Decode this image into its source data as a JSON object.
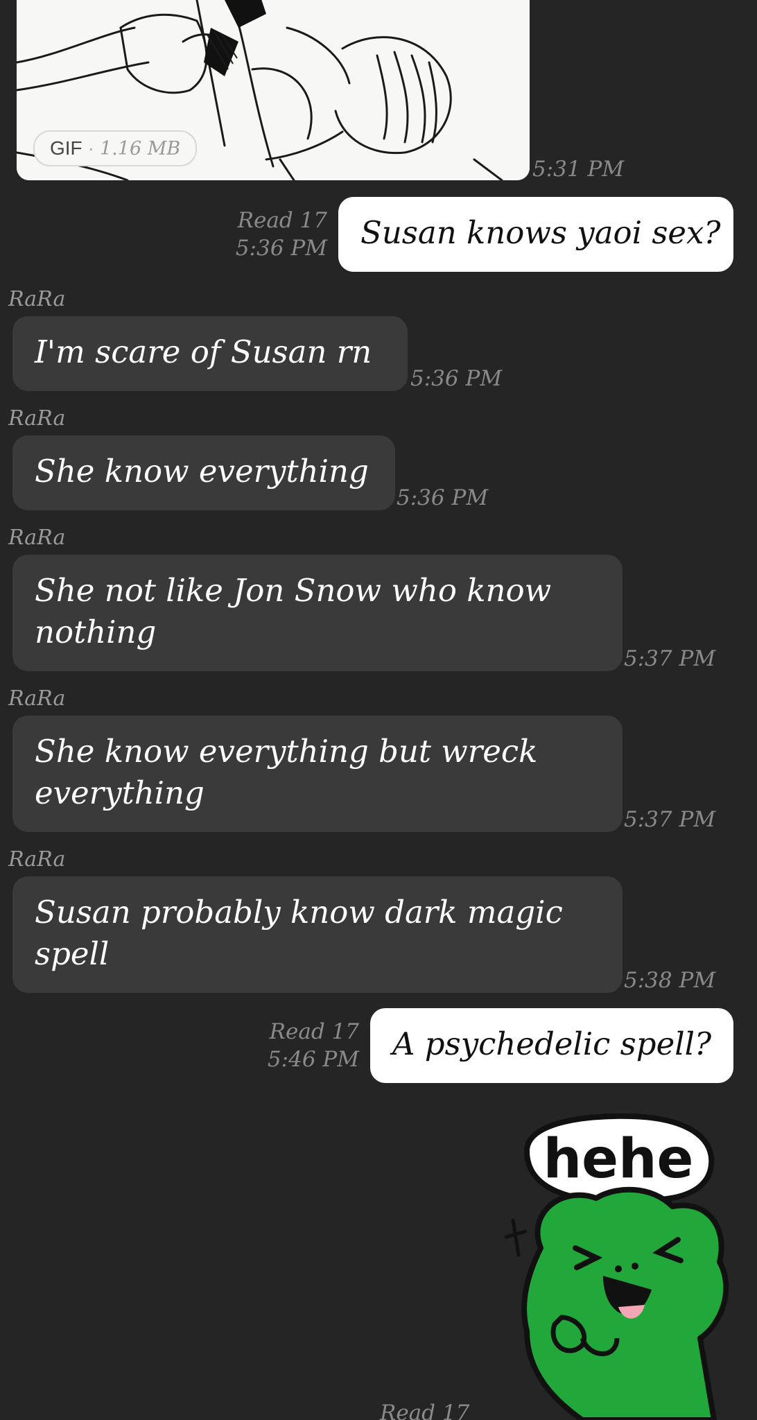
{
  "gif_message": {
    "badge_label": "GIF",
    "badge_size": "1.16 MB",
    "time": "5:31 PM"
  },
  "messages": [
    {
      "direction": "out",
      "text": "Susan knows yaoi sex?",
      "read": "Read 17",
      "time": "5:36 PM"
    },
    {
      "direction": "in",
      "sender": "RaRa",
      "text": "I'm scare of Susan rn",
      "time": "5:36 PM"
    },
    {
      "direction": "in",
      "sender": "RaRa",
      "text": "She know everything",
      "time": "5:36 PM"
    },
    {
      "direction": "in",
      "sender": "RaRa",
      "line1": "She not like Jon Snow who know",
      "line2": "nothing",
      "time": "5:37 PM"
    },
    {
      "direction": "in",
      "sender": "RaRa",
      "line1": "She know everything but wreck",
      "line2": "everything",
      "time": "5:37 PM"
    },
    {
      "direction": "in",
      "sender": "RaRa",
      "line1": "Susan probably know dark magic",
      "line2": "spell",
      "time": "5:38 PM"
    },
    {
      "direction": "out",
      "text": "A psychedelic spell?",
      "read": "Read 17",
      "time": "5:46 PM"
    }
  ],
  "sticker": {
    "text": "hehe",
    "icon": "green-frog-sticker"
  },
  "bottom_read": "Read 17",
  "colors": {
    "background": "#252525",
    "incoming_bubble": "#3a3a3a",
    "outgoing_bubble": "#ffffff",
    "meta_text": "#8a8a8a",
    "sticker_green": "#22a83a"
  }
}
